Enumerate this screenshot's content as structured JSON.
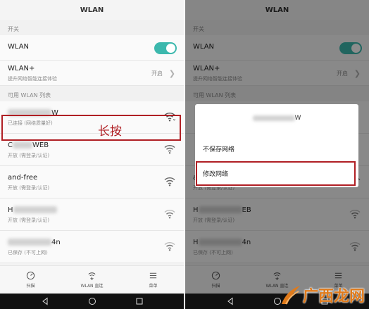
{
  "left": {
    "title": "WLAN",
    "section_switch": "开关",
    "wlan_label": "WLAN",
    "wlan_plus_label": "WLAN+",
    "wlan_plus_sub": "提升网络智能连接体验",
    "wlan_plus_value": "开启",
    "section_list": "可用 WLAN 列表",
    "networks": [
      {
        "name_suffix": "W",
        "status": "已连接 (网络质量好)"
      },
      {
        "name_prefix": "C",
        "name_suffix": "WEB",
        "status": "开放 (需登录/认证)"
      },
      {
        "name_prefix": "and-free",
        "name_suffix": "",
        "status": "开放 (需登录/认证)"
      },
      {
        "name_prefix": "H",
        "name_suffix": "",
        "status": "开放 (需登录/认证)"
      },
      {
        "name_prefix": "",
        "name_suffix": "4n",
        "status": "已保存 (不可上网)"
      }
    ],
    "long_press": "长按"
  },
  "right": {
    "title": "WLAN",
    "section_switch": "开关",
    "wlan_label": "WLAN",
    "wlan_plus_label": "WLAN+",
    "wlan_plus_sub": "提升网络智能连接体验",
    "wlan_plus_value": "开启",
    "section_list": "可用 WLAN 列表",
    "dialog_title_suffix": "W",
    "dialog_option_1": "不保存网络",
    "dialog_option_2": "修改网络",
    "networks": [
      {
        "name_prefix": "and-free",
        "name_suffix": "",
        "status": "开放 (需登录/认证)"
      },
      {
        "name_prefix": "H",
        "name_suffix": "EB",
        "status": "开放 (需登录/认证)"
      },
      {
        "name_prefix": "H",
        "name_suffix": "4n",
        "status": "已保存 (不可上网)"
      }
    ]
  },
  "nav_tabs": [
    {
      "label": "扫描",
      "icon": "scan-icon"
    },
    {
      "label": "WLAN 直连",
      "icon": "wifi-direct-icon"
    },
    {
      "label": "菜单",
      "icon": "menu-icon"
    }
  ],
  "watermark": "广西龙网",
  "colors": {
    "accent": "#3cb8ad",
    "highlight": "#b01f24",
    "watermark": "#e07a1a"
  }
}
